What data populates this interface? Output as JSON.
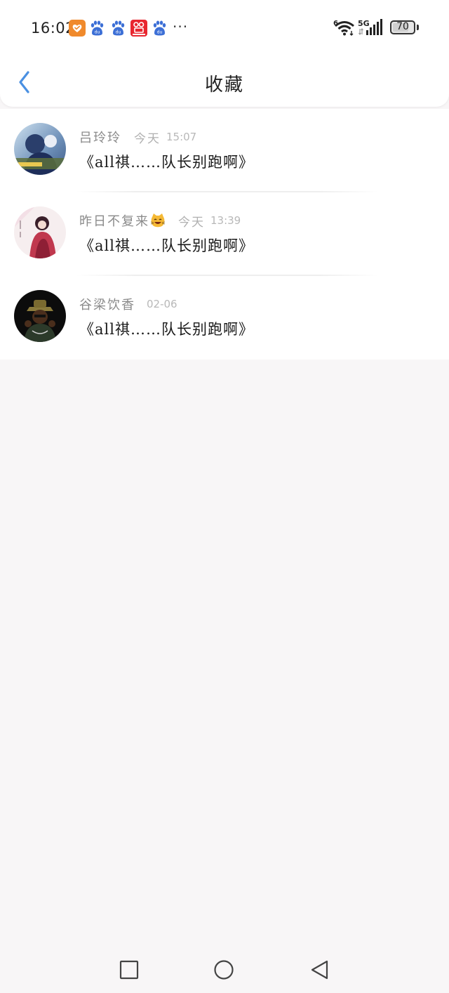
{
  "status_bar": {
    "time": "16:02",
    "more": "···",
    "network_generation": "5G",
    "wifi_badge": "6",
    "battery_level": "70",
    "notification_icons": [
      "health-icon",
      "baidu-paw-icon",
      "baidu-paw-icon",
      "app-icon",
      "baidu-paw-icon"
    ]
  },
  "header": {
    "title": "收藏",
    "back_icon": "chevron-left-icon"
  },
  "colors": {
    "accent": "#4a90e2",
    "background": "#f8f6f7",
    "surface": "#ffffff",
    "muted_text": "#8a8a8a"
  },
  "items": [
    {
      "username": "吕玲玲",
      "date": "今天",
      "time": "15:07",
      "title": "《all祺……队长别跑啊》"
    },
    {
      "username": "昨日不复来",
      "emoji": "cat-face-icon",
      "date": "今天",
      "time": "13:39",
      "title": "《all祺……队长别跑啊》"
    },
    {
      "username": "谷梁饮香",
      "date": "02-06",
      "title": "《all祺……队长别跑啊》"
    }
  ],
  "nav_bar": {
    "buttons": [
      "square-icon",
      "circle-icon",
      "triangle-back-icon"
    ]
  }
}
